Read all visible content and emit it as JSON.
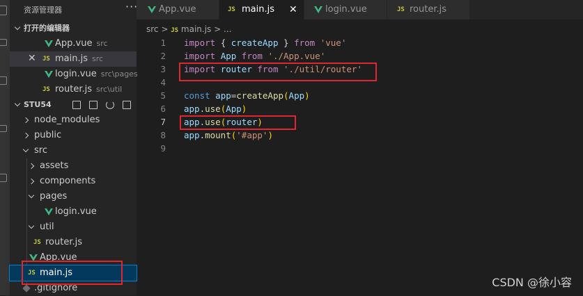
{
  "sidebar": {
    "title": "资源管理器",
    "more": "···",
    "open_editors": {
      "title": "打开的编辑器",
      "items": [
        {
          "name": "App.vue",
          "hint": "src"
        },
        {
          "name": "main.js",
          "hint": "src"
        },
        {
          "name": "login.vue",
          "hint": "src\\pages"
        },
        {
          "name": "router.js",
          "hint": "src\\util"
        }
      ]
    },
    "project": {
      "title": "STU54",
      "tree": {
        "node_modules": "node_modules",
        "public": "public",
        "src": "src",
        "assets": "assets",
        "components": "components",
        "pages": "pages",
        "login_vue": "login.vue",
        "util": "util",
        "router_js": "router.js",
        "app_vue": "App.vue",
        "main_js": "main.js",
        "gitignore": ".gitignore"
      }
    }
  },
  "tabs": [
    {
      "label": "App.vue",
      "type": "vue"
    },
    {
      "label": "main.js",
      "type": "js",
      "active": true
    },
    {
      "label": "login.vue",
      "type": "vue"
    },
    {
      "label": "router.js",
      "type": "js"
    }
  ],
  "breadcrumb": {
    "part1": "src",
    "sep": ">",
    "file": "main.js",
    "more": "..."
  },
  "editor": {
    "line_numbers": [
      "1",
      "2",
      "3",
      "4",
      "5",
      "6",
      "7",
      "8",
      "9"
    ],
    "current_line": "7",
    "code": {
      "l1": {
        "import": "import",
        "open": "{",
        "name": "createApp",
        "close": "}",
        "from": "from",
        "src": "'vue'"
      },
      "l2": {
        "import": "import",
        "name": "App",
        "from": "from",
        "src": "'./App.vue'"
      },
      "l3": {
        "import": "import",
        "name": "router",
        "from": "from",
        "src": "'./util/router'"
      },
      "l5": {
        "const": "const",
        "name": "app",
        "eq": "=",
        "fn": "createApp",
        "open": "(",
        "arg": "App",
        "close": ")"
      },
      "l6": {
        "obj": "app",
        "dot": ".",
        "fn": "use",
        "open": "(",
        "arg": "App",
        "close": ")"
      },
      "l7": {
        "obj": "app",
        "dot": ".",
        "fn": "use",
        "open": "(",
        "arg": "router",
        "close": ")"
      },
      "l8": {
        "obj": "app",
        "dot": ".",
        "fn": "mount",
        "open": "(",
        "arg": "'#app'",
        "close": ")"
      }
    }
  },
  "watermark": "CSDN @徐小容",
  "colors": {
    "highlight_box": "#e0262f",
    "vue_green": "#41b883",
    "js_yellow": "#cbcb41"
  }
}
